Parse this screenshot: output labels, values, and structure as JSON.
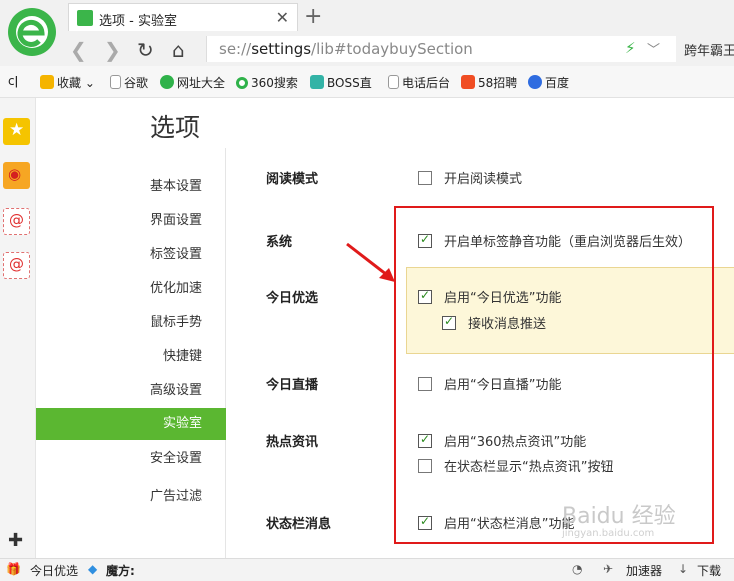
{
  "browser": {
    "tab_title": "选项 - 实验室",
    "url_prefix": "se://",
    "url_main": "settings",
    "url_rest": "/lib#todaybuySection",
    "right_text": "跨年霸王",
    "accent": "#3bb54a"
  },
  "bookmarks": [
    {
      "label": "收藏",
      "icon": "star-icon",
      "color": "#f5b400"
    },
    {
      "label": "谷歌",
      "icon": "page-icon",
      "color": "#d0d0d0"
    },
    {
      "label": "网址大全",
      "icon": "360-icon",
      "color": "#2fb24a"
    },
    {
      "label": "360搜索",
      "icon": "360search-icon",
      "color": "#2fb24a"
    },
    {
      "label": "BOSS直",
      "icon": "boss-icon",
      "color": "#33b3a6"
    },
    {
      "label": "电话后台",
      "icon": "page-icon",
      "color": "#d0d0d0"
    },
    {
      "label": "58招聘",
      "icon": "58-icon",
      "color": "#f04d23"
    },
    {
      "label": "百度",
      "icon": "baidu-icon",
      "color": "#2f6ce0"
    }
  ],
  "page": {
    "title": "选项"
  },
  "sidenav": [
    {
      "label": "基本设置",
      "active": false
    },
    {
      "label": "界面设置",
      "active": false
    },
    {
      "label": "标签设置",
      "active": false
    },
    {
      "label": "优化加速",
      "active": false
    },
    {
      "label": "鼠标手势",
      "active": false
    },
    {
      "label": "快捷键",
      "active": false
    },
    {
      "label": "高级设置",
      "active": false
    },
    {
      "label": "实验室",
      "active": true
    },
    {
      "label": "安全设置",
      "active": false
    },
    {
      "label": "广告过滤",
      "active": false
    }
  ],
  "sections": [
    {
      "label": "阅读模式",
      "options": [
        {
          "text": "开启阅读模式",
          "checked": false
        }
      ]
    },
    {
      "label": "系统",
      "options": [
        {
          "text": "开启单标签静音功能（重启浏览器后生效）",
          "checked": true
        }
      ]
    },
    {
      "label": "今日优选",
      "options": [
        {
          "text": "启用“今日优选”功能",
          "checked": true
        },
        {
          "text": "接收消息推送",
          "checked": true
        }
      ]
    },
    {
      "label": "今日直播",
      "options": [
        {
          "text": "启用“今日直播”功能",
          "checked": false
        }
      ]
    },
    {
      "label": "热点资讯",
      "options": [
        {
          "text": "启用“360热点资讯”功能",
          "checked": true
        },
        {
          "text": "在状态栏显示“热点资讯”按钮",
          "checked": false
        }
      ]
    },
    {
      "label": "状态栏消息",
      "options": [
        {
          "text": "启用“状态栏消息”功能",
          "checked": true
        }
      ]
    }
  ],
  "statusbar": {
    "today": "今日优选",
    "magic": "魔方:",
    "accelerator": "加速器",
    "download": "下载"
  },
  "watermark": {
    "text": "Baidu 经验",
    "sub": "jingyan.baidu.com"
  }
}
